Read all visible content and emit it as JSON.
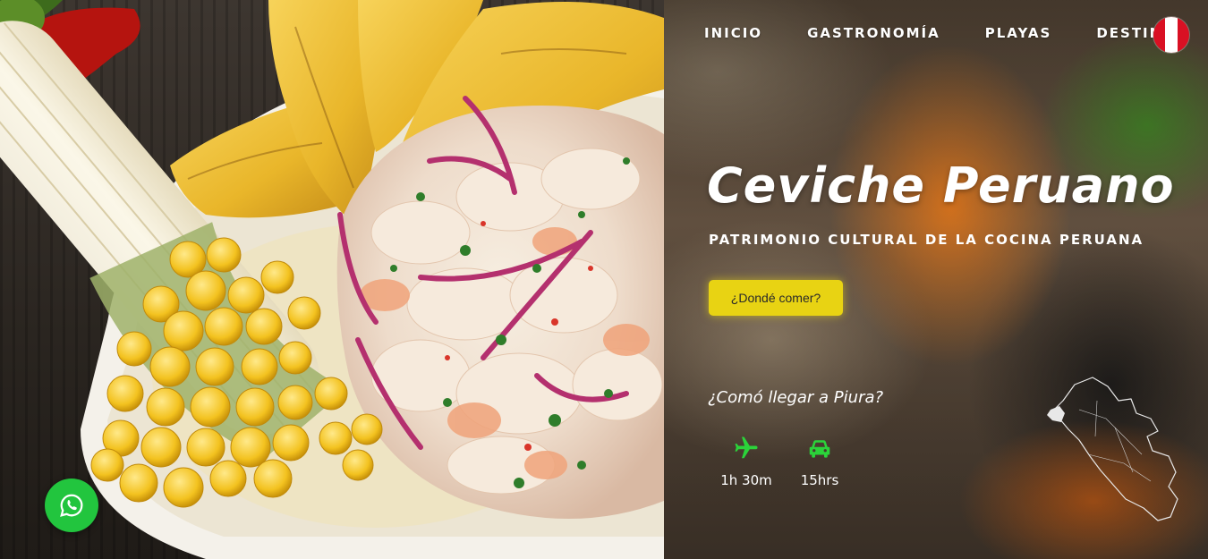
{
  "nav": {
    "items": [
      "INICIO",
      "GASTRONOMÍA",
      "PLAYAS",
      "DESTINOS"
    ]
  },
  "hero": {
    "title": "Ceviche Peruano",
    "subtitle": "PATRIMONIO CULTURAL DE LA COCINA PERUANA",
    "cta_label": "¿Dondé comer?"
  },
  "travel": {
    "question": "¿Comó llegar a Piura?",
    "plane_time": "1h 30m",
    "car_time": "15hrs"
  },
  "icons": {
    "flag": "peru-flag-icon",
    "plane": "plane-icon",
    "car": "car-icon",
    "map": "peru-map-icon",
    "whatsapp": "whatsapp-icon"
  },
  "colors": {
    "cta_background": "#e8d313",
    "travel_icons": "#2bd33a",
    "whatsapp": "#22c53e",
    "flag_red": "#d91023"
  }
}
